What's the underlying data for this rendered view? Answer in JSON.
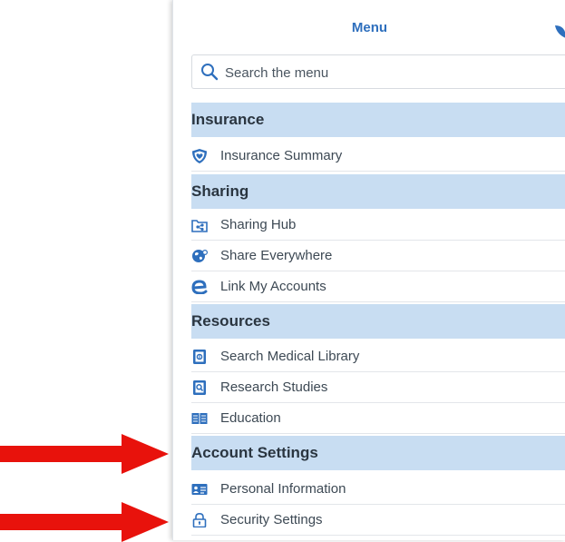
{
  "menu": {
    "title": "Menu"
  },
  "search": {
    "placeholder": "Search the menu"
  },
  "sections": {
    "insurance": "Insurance",
    "sharing": "Sharing",
    "resources": "Resources",
    "account": "Account Settings"
  },
  "items": {
    "insurance_summary": {
      "label": "Insurance Summary",
      "icon": "shield-icon"
    },
    "sharing_hub": {
      "label": "Sharing Hub",
      "icon": "folder-share-icon"
    },
    "share_everywhere": {
      "label": "Share Everywhere",
      "icon": "globe-share-icon"
    },
    "link_accounts": {
      "label": "Link My Accounts",
      "icon": "link-e-icon"
    },
    "medical_library": {
      "label": "Search Medical Library",
      "icon": "library-icon"
    },
    "research_studies": {
      "label": "Research Studies",
      "icon": "research-icon"
    },
    "education": {
      "label": "Education",
      "icon": "book-icon"
    },
    "personal_info": {
      "label": "Personal Information",
      "icon": "id-card-icon"
    },
    "security_settings": {
      "label": "Security Settings",
      "icon": "lock-icon"
    }
  },
  "colors": {
    "accent": "#2e6fbd",
    "section_bg": "#c8ddf2",
    "arrow": "#e8120c"
  }
}
